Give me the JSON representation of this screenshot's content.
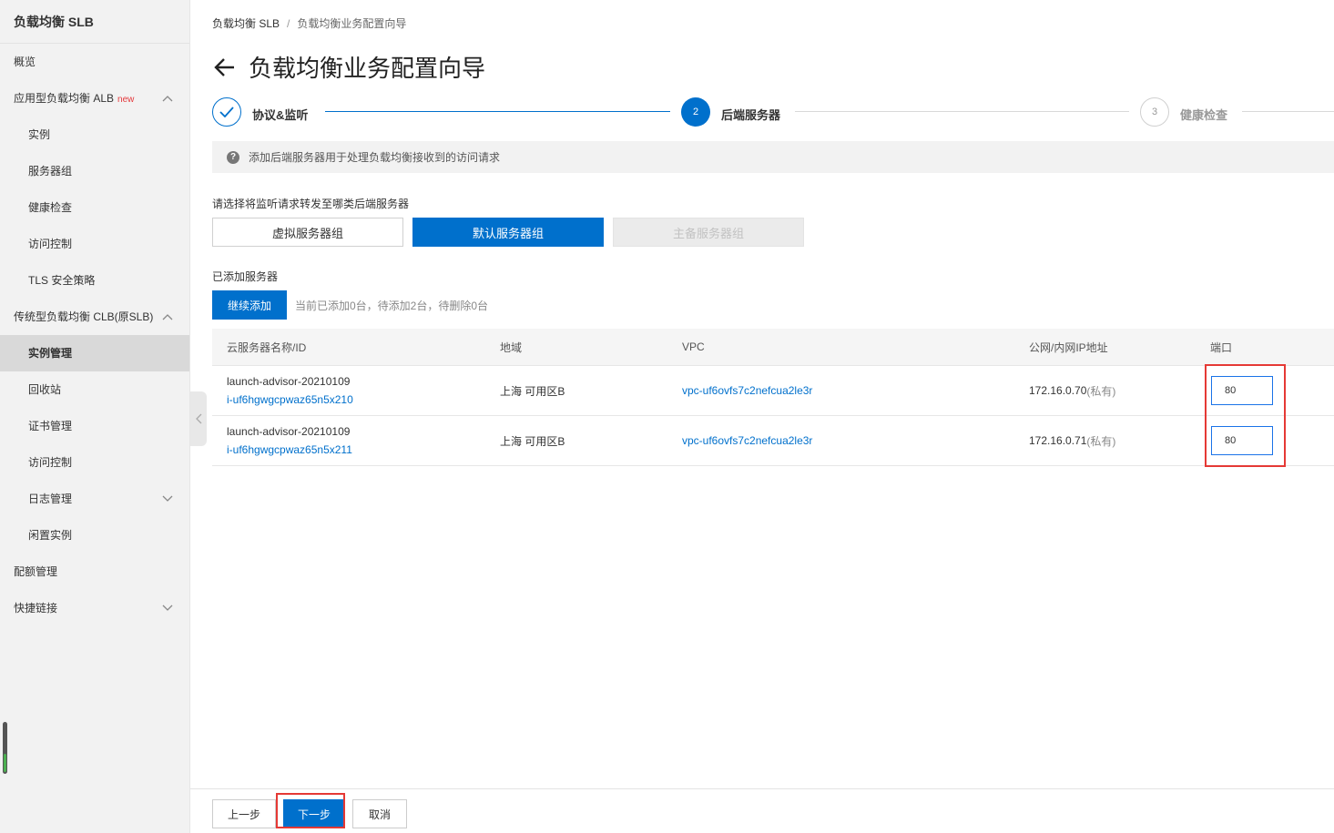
{
  "sidebar": {
    "title": "负载均衡 SLB",
    "items": [
      {
        "label": "概览"
      },
      {
        "label": "应用型负载均衡 ALB",
        "badge": "new"
      },
      {
        "label": "实例"
      },
      {
        "label": "服务器组"
      },
      {
        "label": "健康检查"
      },
      {
        "label": "访问控制"
      },
      {
        "label": "TLS 安全策略"
      },
      {
        "label": "传统型负载均衡 CLB(原SLB)"
      },
      {
        "label": "实例管理"
      },
      {
        "label": "回收站"
      },
      {
        "label": "证书管理"
      },
      {
        "label": "访问控制"
      },
      {
        "label": "日志管理"
      },
      {
        "label": "闲置实例"
      },
      {
        "label": "配额管理"
      },
      {
        "label": "快捷链接"
      }
    ]
  },
  "breadcrumb": {
    "root": "负载均衡 SLB",
    "separator": "/",
    "current": "负载均衡业务配置向导"
  },
  "page": {
    "title": "负载均衡业务配置向导"
  },
  "steps": [
    {
      "label": "协议&监听",
      "status": "done"
    },
    {
      "number": "2",
      "label": "后端服务器",
      "status": "active"
    },
    {
      "number": "3",
      "label": "健康检查",
      "status": "pending"
    }
  ],
  "notice": {
    "text": "添加后端服务器用于处理负载均衡接收到的访问请求"
  },
  "forward": {
    "label": "请选择将监听请求转发至哪类后端服务器",
    "options": [
      "虚拟服务器组",
      "默认服务器组",
      "主备服务器组"
    ],
    "selected": "默认服务器组"
  },
  "added": {
    "label": "已添加服务器",
    "add_button": "继续添加",
    "hint": "当前已添加0台，待添加2台，待删除0台"
  },
  "table": {
    "headers": [
      "云服务器名称/ID",
      "地域",
      "VPC",
      "公网/内网IP地址",
      "端口"
    ],
    "rows": [
      {
        "name": "launch-advisor-20210109",
        "id": "i-uf6hgwgcpwaz65n5x210",
        "region": "上海 可用区B",
        "vpc": "vpc-uf6ovfs7c2nefcua2le3r",
        "ip": "172.16.0.70",
        "ip_type": "(私有)",
        "port": "80"
      },
      {
        "name": "launch-advisor-20210109",
        "id": "i-uf6hgwgcpwaz65n5x211",
        "region": "上海 可用区B",
        "vpc": "vpc-uf6ovfs7c2nefcua2le3r",
        "ip": "172.16.0.71",
        "ip_type": "(私有)",
        "port": "80"
      }
    ]
  },
  "footer": {
    "prev": "上一步",
    "next": "下一步",
    "cancel": "取消"
  },
  "colors": {
    "primary": "#0070cc",
    "highlight": "#e53935"
  }
}
